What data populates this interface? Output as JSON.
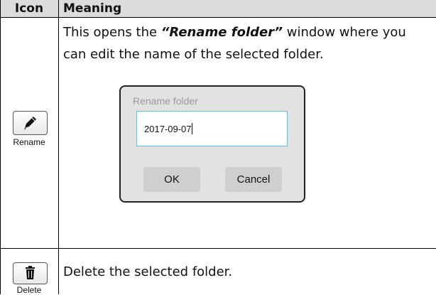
{
  "header": {
    "icon": "Icon",
    "meaning": "Meaning"
  },
  "rows": [
    {
      "icon_name": "pencil-icon",
      "icon_label": "Rename",
      "description_before": "This opens the ",
      "description_emph": "“Rename folder”",
      "description_after": " window where you can edit the name of the selected folder.",
      "dialog": {
        "title": "Rename folder",
        "input_value": "2017-09-07",
        "ok_label": "OK",
        "cancel_label": "Cancel"
      }
    },
    {
      "icon_name": "trash-icon",
      "icon_label": "Delete",
      "description": "Delete the selected folder."
    }
  ]
}
